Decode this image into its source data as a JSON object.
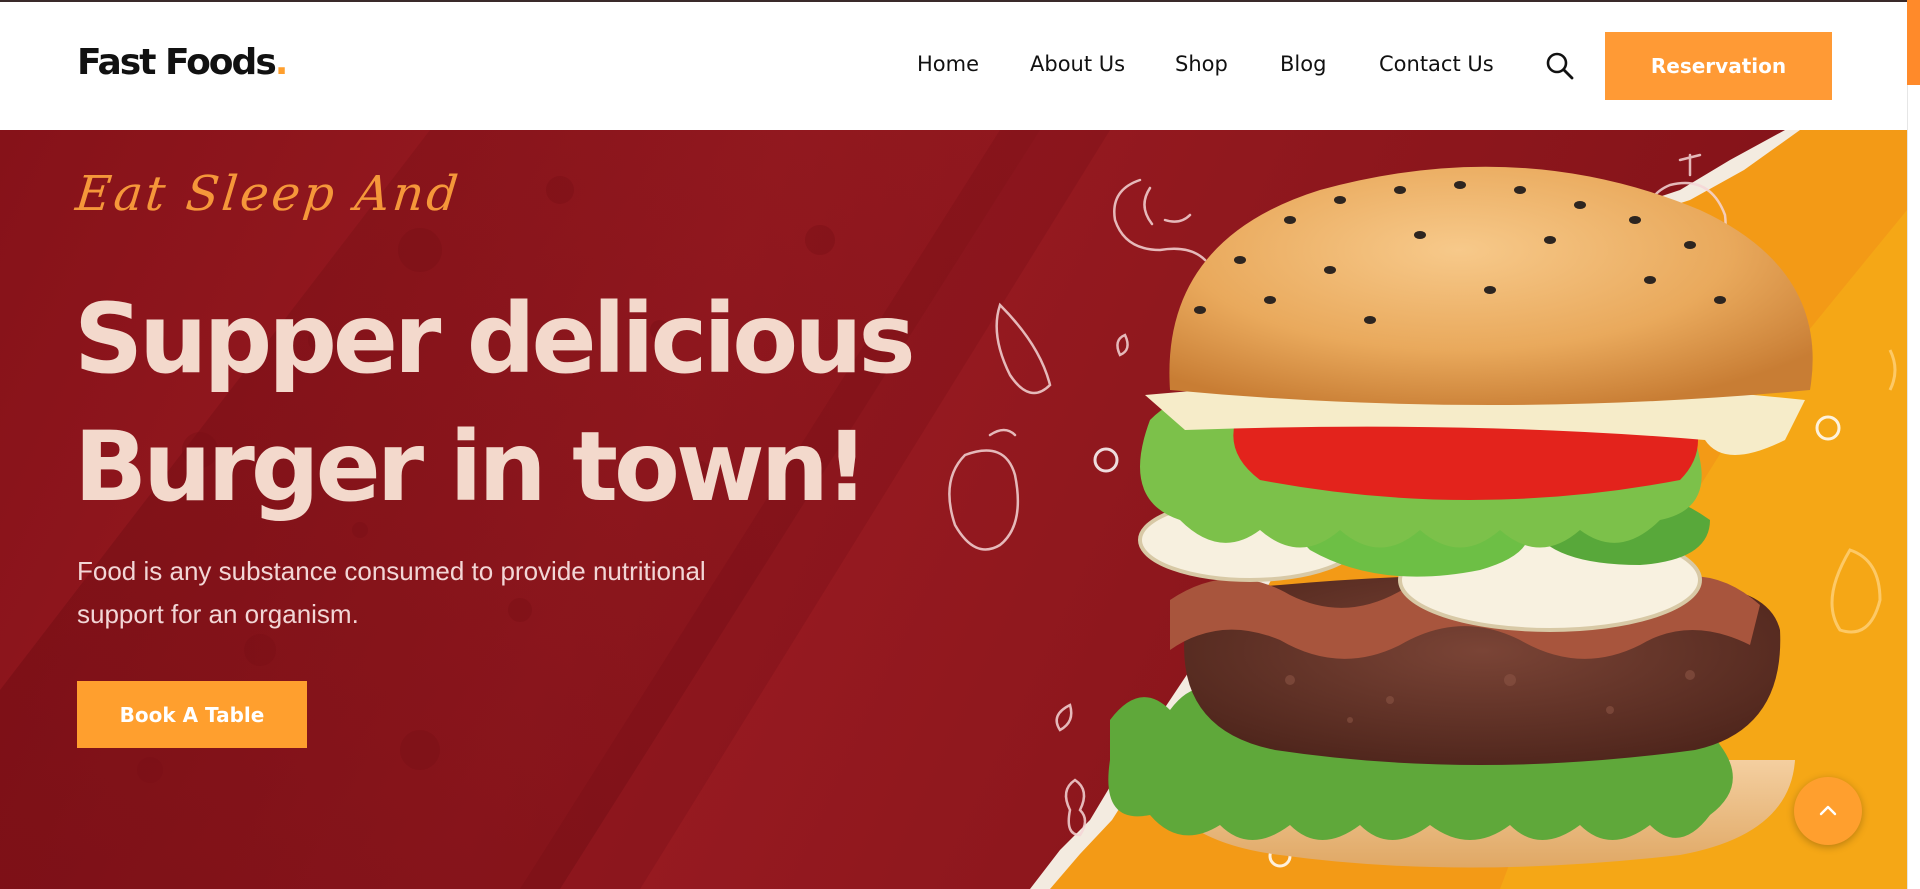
{
  "header": {
    "logo_text": "Fast Foods",
    "logo_dot": ".",
    "nav": [
      {
        "label": "Home"
      },
      {
        "label": "About Us"
      },
      {
        "label": "Shop"
      },
      {
        "label": "Blog"
      },
      {
        "label": "Contact Us"
      }
    ],
    "search_icon": "search-icon",
    "reservation_label": "Reservation"
  },
  "hero": {
    "tagline": "Eat Sleep And",
    "headline_line1": "Supper delicious",
    "headline_line2": "Burger in town!",
    "description": "Food is any substance consumed to provide nutritional support for an organism.",
    "cta_label": "Book A Table",
    "image": "burger-image"
  },
  "scroll_top_icon": "chevron-up-icon",
  "colors": {
    "accent": "#ff9f2e",
    "hero_red": "#8e171d",
    "hero_text": "#f3d9cc",
    "tagline": "#f5973a",
    "panel_yellow": "#f7a21b"
  }
}
